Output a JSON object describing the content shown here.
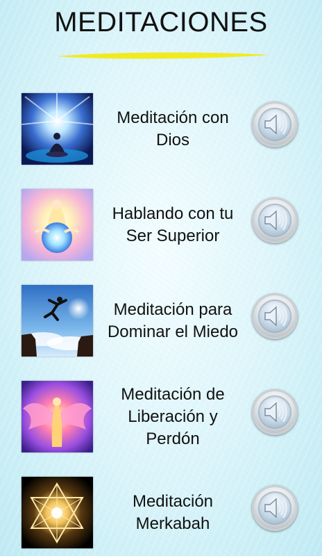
{
  "header": {
    "title": "MEDITACIONES"
  },
  "meditations": [
    {
      "line1": "Meditación con",
      "line2": "Dios",
      "line3": "",
      "image_icon": "meditating-figure-light-icon",
      "audio_icon": "speaker-icon"
    },
    {
      "line1": "Hablando con tu",
      "line2": "Ser Superior",
      "line3": "",
      "image_icon": "radiant-being-icon",
      "audio_icon": "speaker-icon"
    },
    {
      "line1": "Meditación para",
      "line2": "Dominar el Miedo",
      "line3": "",
      "image_icon": "jumping-man-cliff-icon",
      "audio_icon": "speaker-icon"
    },
    {
      "line1": "Meditación de",
      "line2": "Liberación y",
      "line3": "Perdón",
      "image_icon": "angel-wings-icon",
      "audio_icon": "speaker-icon"
    },
    {
      "line1": "Meditación",
      "line2": "Merkabah",
      "line3": "",
      "image_icon": "merkabah-star-icon",
      "audio_icon": "speaker-icon"
    }
  ],
  "colors": {
    "underline": "#f2ea1f",
    "text": "#111111"
  }
}
